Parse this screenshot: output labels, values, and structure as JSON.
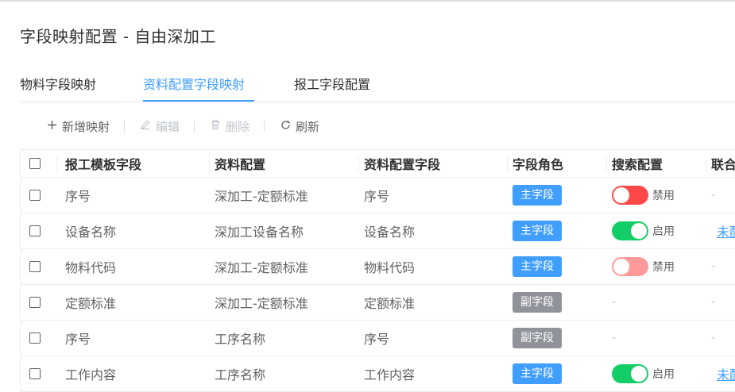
{
  "title": "字段映射配置 - 自由深加工",
  "tabs": [
    {
      "label": "物料字段映射"
    },
    {
      "label": "资料配置字段映射"
    },
    {
      "label": "报工字段配置"
    }
  ],
  "active_tab": 1,
  "toolbar": {
    "add_label": "新增映射",
    "edit_label": "编辑",
    "delete_label": "删除",
    "refresh_label": "刷新"
  },
  "table": {
    "headers": [
      "报工模板字段",
      "资料配置",
      "资料配置字段",
      "字段角色",
      "搜索配置",
      "联合"
    ],
    "rows": [
      {
        "template_field": "序号",
        "config": "深加工-定额标准",
        "config_field": "序号",
        "role": "主字段",
        "role_type": "main",
        "search": "禁用",
        "search_state": "off",
        "union": "-"
      },
      {
        "template_field": "设备名称",
        "config": "深加工设备名称",
        "config_field": "设备名称",
        "role": "主字段",
        "role_type": "main",
        "search": "启用",
        "search_state": "on",
        "union": "未配"
      },
      {
        "template_field": "物料代码",
        "config": "深加工-定额标准",
        "config_field": "物料代码",
        "role": "主字段",
        "role_type": "main",
        "search": "禁用",
        "search_state": "off-light",
        "union": "-"
      },
      {
        "template_field": "定额标准",
        "config": "深加工-定额标准",
        "config_field": "定额标准",
        "role": "副字段",
        "role_type": "sub",
        "search": "-",
        "search_state": "none",
        "union": "-"
      },
      {
        "template_field": "序号",
        "config": "工序名称",
        "config_field": "序号",
        "role": "副字段",
        "role_type": "sub",
        "search": "-",
        "search_state": "none",
        "union": "-"
      },
      {
        "template_field": "工作内容",
        "config": "工序名称",
        "config_field": "工作内容",
        "role": "主字段",
        "role_type": "main",
        "search": "启用",
        "search_state": "on",
        "union": "未配"
      }
    ]
  },
  "colors": {
    "accent": "#409eff",
    "switch_on": "#13ce66",
    "switch_off": "#ff4949",
    "tag_sub": "#909399"
  },
  "icons": {
    "add": "plus-icon",
    "edit": "pencil-icon",
    "delete": "trash-icon",
    "refresh": "refresh-icon"
  }
}
